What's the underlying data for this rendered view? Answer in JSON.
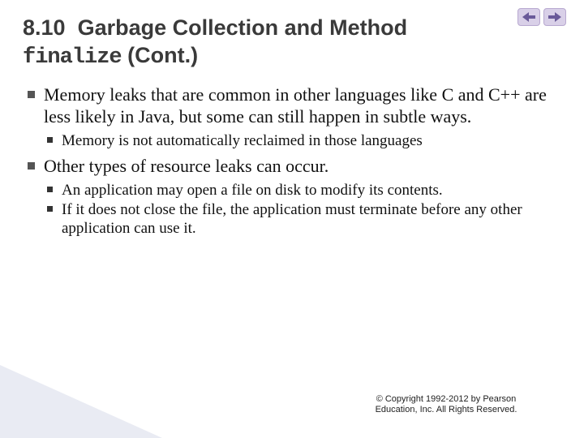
{
  "nav": {
    "prev_icon": "prev-arrow",
    "next_icon": "next-arrow"
  },
  "title": {
    "section_no": "8.10",
    "main": "Garbage Collection and Method",
    "code": "finalize",
    "suffix": "(Cont.)"
  },
  "bullets": [
    {
      "text": "Memory leaks that are common in other languages like C and C++ are less likely in Java, but some can still happen in subtle ways.",
      "sub": [
        "Memory is not automatically reclaimed in those languages"
      ]
    },
    {
      "text": "Other types of resource leaks can occur.",
      "sub": [
        "An application may open a file on disk to modify its contents.",
        "If it does not close the file, the application must terminate before any other application can use it."
      ]
    }
  ],
  "footer": {
    "line1": "© Copyright 1992-2012 by Pearson",
    "line2": "Education, Inc. All Rights Reserved."
  }
}
